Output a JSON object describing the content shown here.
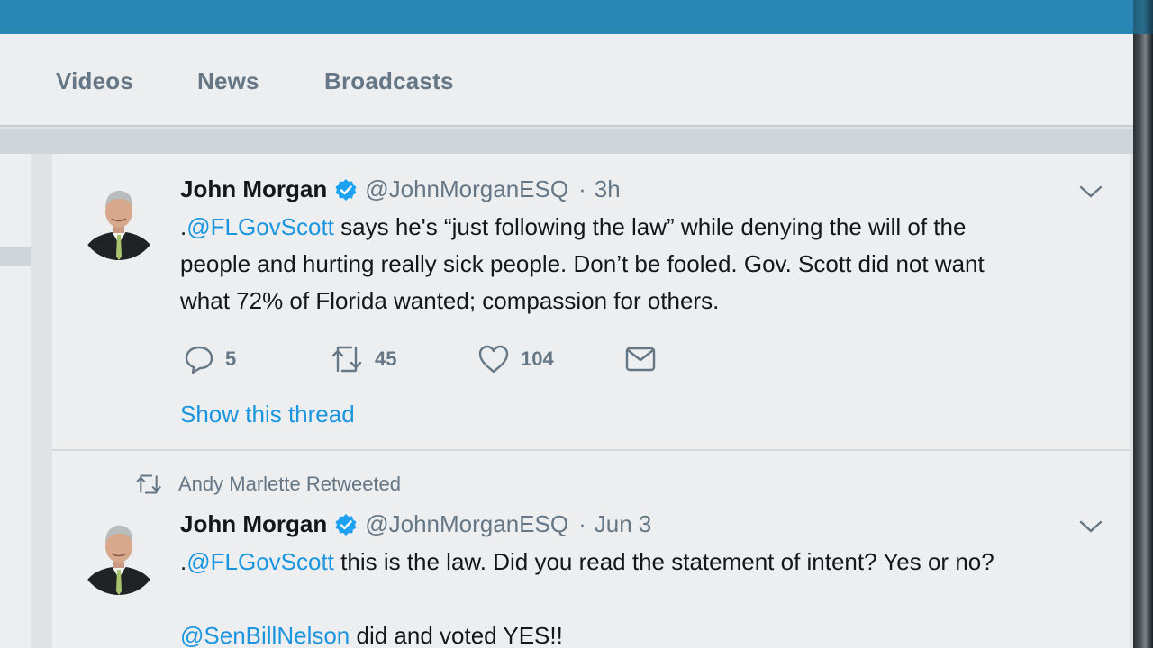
{
  "nav": {
    "tabs": [
      {
        "label": "Videos"
      },
      {
        "label": "News"
      },
      {
        "label": "Broadcasts"
      }
    ]
  },
  "tweets": [
    {
      "author": "John Morgan",
      "handle": "@JohnMorganESQ",
      "separator": "·",
      "time": "3h",
      "mention": "@FLGovScott",
      "text_prefix": ".",
      "text_line1_rest": " says he's “just following the law” while denying the will of the",
      "text_line2": "people and hurting really sick people. Don’t be fooled. Gov. Scott did not want",
      "text_line3": "what 72% of Florida wanted; compassion for others.",
      "replies": "5",
      "retweets": "45",
      "likes": "104",
      "thread_link": "Show this thread"
    },
    {
      "retweeted_by": "Andy Marlette Retweeted",
      "author": "John Morgan",
      "handle": "@JohnMorganESQ",
      "separator": "·",
      "time": "Jun 3",
      "text_prefix": ".",
      "mention": "@FLGovScott",
      "text_line1_rest": " this is the law. Did you read the statement of intent? Yes or no?",
      "mention2": "@SenBillNelson",
      "text_line3_rest": " did and voted YES!!"
    }
  ],
  "colors": {
    "top_bar": "#2a87b5",
    "link": "#1b95e0",
    "muted": "#657786",
    "verified": "#1da1f2"
  },
  "icons": [
    "reply-icon",
    "retweet-icon",
    "like-icon",
    "direct-message-icon",
    "verified-badge-icon",
    "chevron-down-icon"
  ]
}
